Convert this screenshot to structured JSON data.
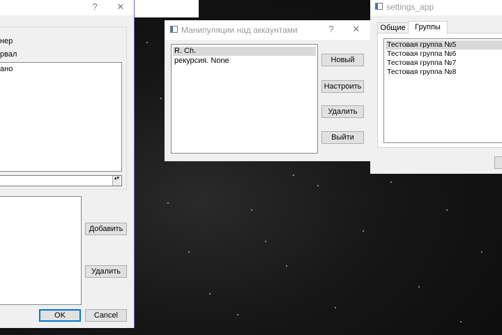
{
  "left_dialog": {
    "help_label": "?",
    "close_label": "✕",
    "row1_text": "нер",
    "row2_text": "рвал",
    "box_text": "ано",
    "spin_arrows": "▴▾",
    "add_label": "Добавить",
    "delete_label": "Удалить",
    "ok_label": "OK",
    "cancel_label": "Cancel"
  },
  "accounts_dialog": {
    "title": "Манипуляции над аккаунтами",
    "help_label": "?",
    "close_label": "✕",
    "list_items": [
      "R. Ch.",
      "рекурсия. None"
    ],
    "buttons": {
      "new": "Новый",
      "configure": "Настроить",
      "delete": "Удалить",
      "exit": "Выйти"
    }
  },
  "settings_app": {
    "title": "settings_app",
    "tabs": [
      "Общие",
      "Группы"
    ],
    "active_tab": "Группы",
    "groups": [
      "Тестовая группа №5",
      "Тестовая группа №6",
      "Тестовая группа №7",
      "Тестовая группа №8"
    ]
  },
  "colors": {
    "selection": "#d9d9d9",
    "default_button_border": "#0078d7",
    "left_window_border": "#6b5fc7"
  }
}
